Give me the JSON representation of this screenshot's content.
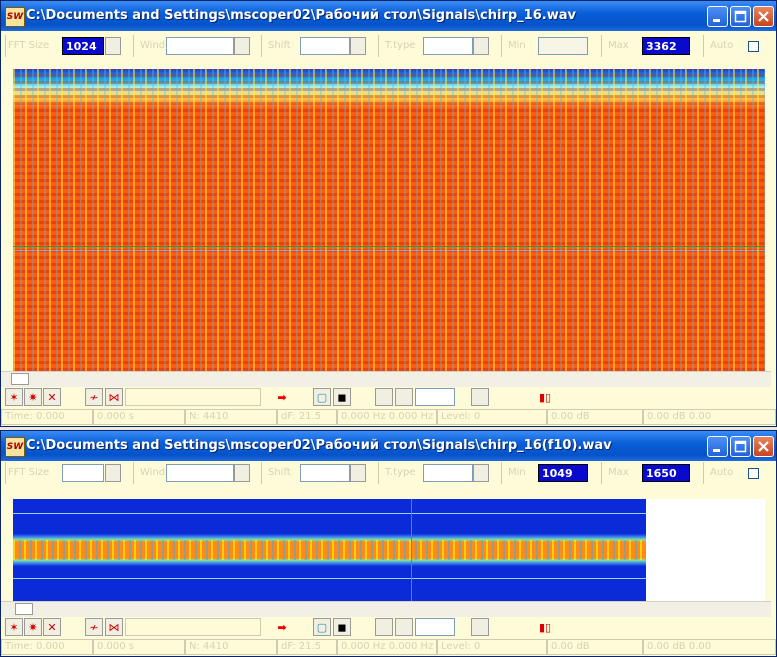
{
  "win1": {
    "title": "C:\\Documents and Settings\\mscoper02\\Рабочий стол\\Signals\\chirp_16.wav",
    "toolbar": {
      "fft_label": "FFT Size",
      "fft_value": "1024",
      "field2_label": "Wind",
      "field3_label": "Shift",
      "field4_label": "T.type",
      "min_label": "Min",
      "min_value": "",
      "max_label": "Max",
      "max_value": "3362",
      "auto_label": "Auto"
    },
    "status": [
      "Time: 0.000",
      "0.000 s",
      "N: 4410",
      "dF: 21.5",
      "",
      "0.000 Hz  0.000 Hz",
      "Level: 0",
      "",
      "0.00 dB",
      "0.00 dB  0.00"
    ]
  },
  "win2": {
    "title": "C:\\Documents and Settings\\mscoper02\\Рабочий стол\\Signals\\chirp_16(f10).wav",
    "toolbar": {
      "fft_label": "FFT Size",
      "fft_value": "",
      "field2_label": "Wind",
      "field3_label": "Shift",
      "field4_label": "T.type",
      "min_label": "Min",
      "min_value": "1049",
      "max_label": "Max",
      "max_value": "1650",
      "auto_label": "Auto"
    },
    "status": [
      "Time: 0.000",
      "0.000 s",
      "N: 4410",
      "dF: 21.5",
      "",
      "0.000 Hz  0.000 Hz",
      "Level: 0",
      "",
      "0.00 dB",
      "0.00 dB  0.00"
    ]
  },
  "app_icon_text": "SW",
  "colors": {
    "titlebar": "#0553c9",
    "field_dark": "#0a0acc",
    "window_bg": "#fdfbd8"
  },
  "icons": [
    "app-icon",
    "minimize-icon",
    "maximize-icon",
    "close-icon",
    "zoom-in-icon",
    "zoom-out-icon",
    "no-zoom-icon",
    "wave-icon",
    "wave-cross-icon",
    "play-arrow-icon",
    "copy-icon",
    "stop-icon",
    "spectrum-icon"
  ]
}
